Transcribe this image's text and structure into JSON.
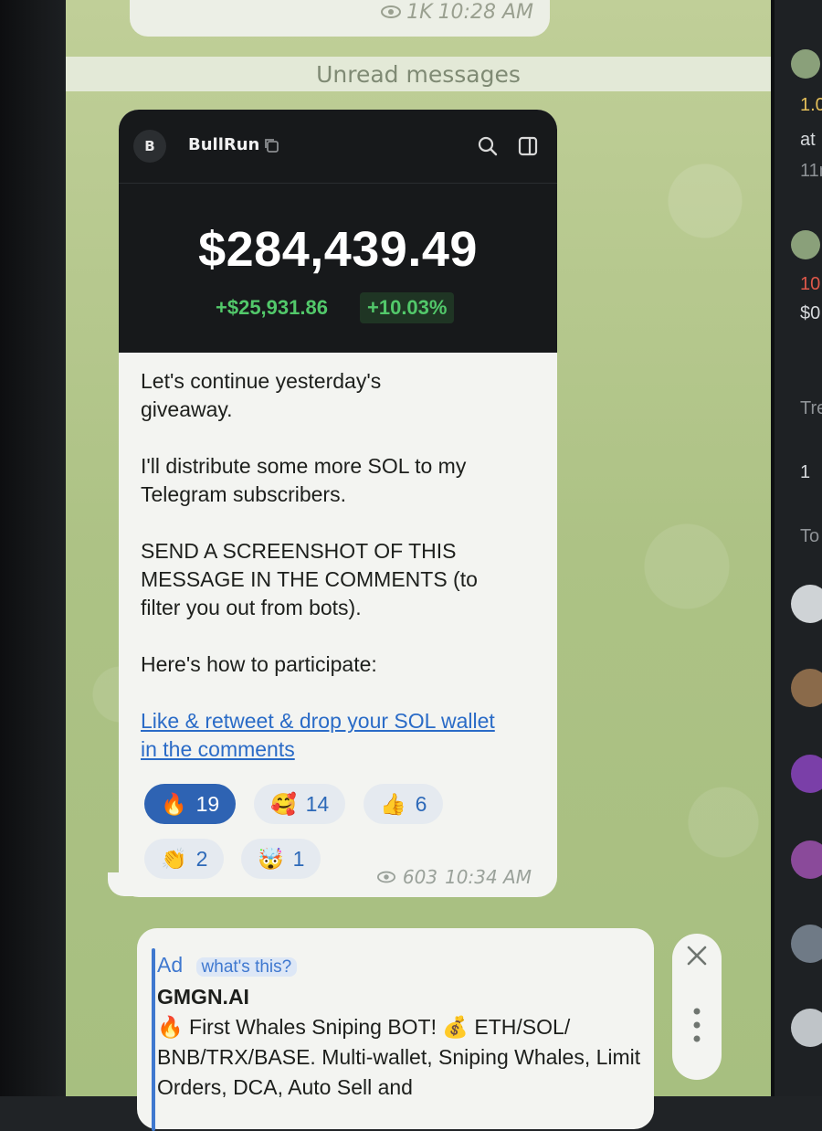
{
  "previous_message": {
    "views": "1K",
    "time": "10:28 AM"
  },
  "unread_separator": "Unread messages",
  "post": {
    "card": {
      "avatar_letter": "B",
      "brand": "BullRun",
      "balance": "$284,439.49",
      "change_amount": "+$25,931.86",
      "change_percent": "+10.03%"
    },
    "paragraphs": [
      "Let's continue yesterday's giveaway.",
      "I'll distribute some more SOL to my Telegram subscribers.",
      "SEND A SCREENSHOT OF THIS MESSAGE IN THE COMMENTS (to filter you out from bots).",
      "Here's how to participate:"
    ],
    "link_text": "Like & retweet & drop your SOL wallet in the comments",
    "reactions": [
      {
        "emoji": "🔥",
        "count": "19",
        "active": true
      },
      {
        "emoji": "🥰",
        "count": "14",
        "active": false
      },
      {
        "emoji": "👍",
        "count": "6",
        "active": false
      },
      {
        "emoji": "👏",
        "count": "2",
        "active": false
      },
      {
        "emoji": "🤯",
        "count": "1",
        "active": false
      }
    ],
    "views": "603",
    "time": "10:34 AM"
  },
  "ad": {
    "label": "Ad",
    "whats_this": "what's this?",
    "title": "GMGN.AI",
    "body": "🔥 First Whales Sniping BOT! 💰 ETH/SOL/ BNB/TRX/BASE. Multi-wallet, Sniping Whales, Limit Orders, DCA, Auto Sell and"
  },
  "right_panel": {
    "snippets": [
      "1.0",
      "at",
      "11m",
      "10.",
      "$0",
      "Tre",
      "1",
      "To"
    ]
  }
}
